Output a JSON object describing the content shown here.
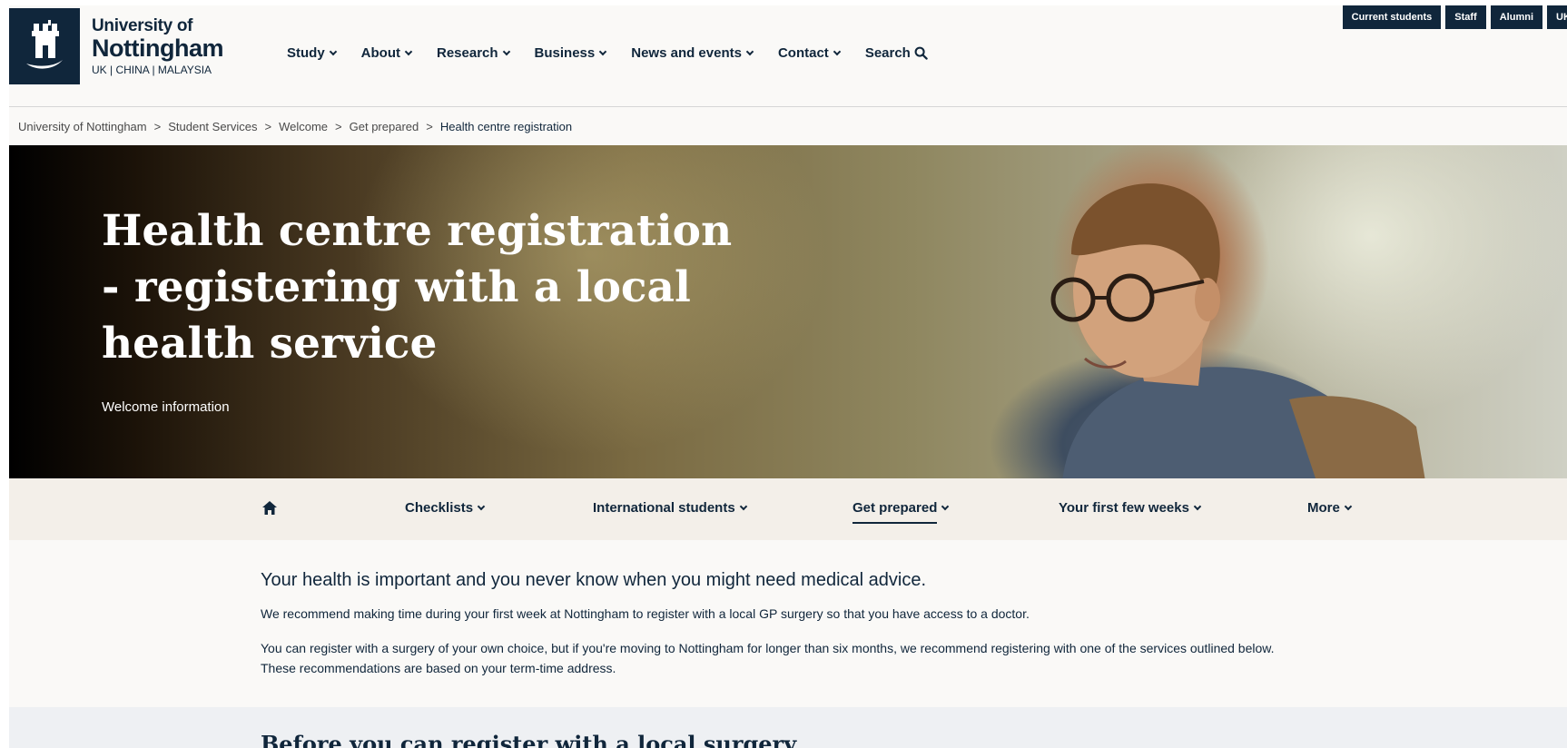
{
  "utility": {
    "current_students": "Current students",
    "staff": "Staff",
    "alumni": "Alumni",
    "region": "UK"
  },
  "logo": {
    "line1": "University of",
    "line2": "Nottingham",
    "campuses": "UK | CHINA | MALAYSIA"
  },
  "nav": {
    "study": "Study",
    "about": "About",
    "research": "Research",
    "business": "Business",
    "news": "News and events",
    "contact": "Contact",
    "search": "Search"
  },
  "breadcrumb": {
    "items": [
      "University of Nottingham",
      "Student Services",
      "Welcome",
      "Get prepared"
    ],
    "separator": ">",
    "current": "Health centre registration"
  },
  "hero": {
    "title": "Health centre registration - registering with a local health service",
    "subtitle": "Welcome information"
  },
  "section_nav": {
    "checklists": "Checklists",
    "international": "International students",
    "get_prepared": "Get prepared",
    "first_weeks": "Your first few weeks",
    "more": "More",
    "active": "Get prepared"
  },
  "content": {
    "lead": "Your health is important and you never know when you might need medical advice.",
    "para1": "We recommend making time during your first week at Nottingham to register with a local GP surgery so that you have access to a doctor.",
    "para2": "You can register with a surgery of your own choice, but if you're moving to Nottingham for longer than six months, we recommend registering with one of the services outlined below. These recommendations are based on your term-time address.",
    "next_heading": "Before you can register with a local surgery"
  },
  "colors": {
    "brand_navy": "#10263b",
    "page_bg": "#faf9f7",
    "secnav_bg": "#f3efe9"
  }
}
